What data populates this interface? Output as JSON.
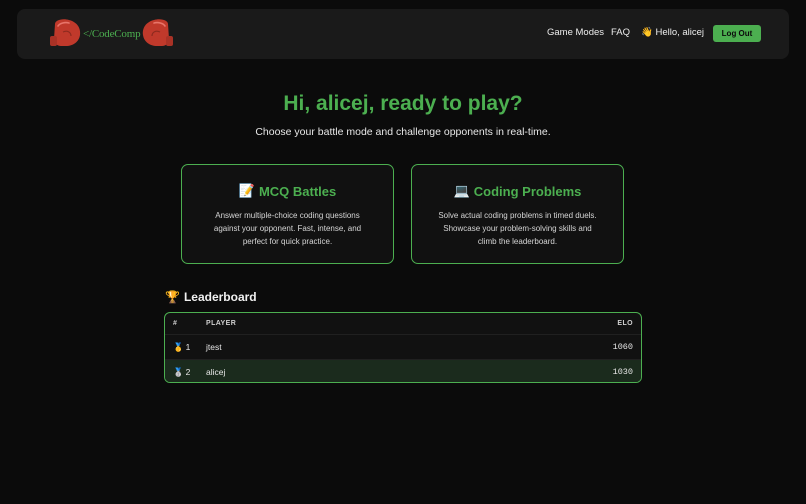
{
  "nav": {
    "logo_text": "</CodeComp",
    "links": [
      "Game Modes",
      "FAQ"
    ],
    "greeting": "👋 Hello, alicej",
    "logout_label": "Log Out"
  },
  "hero": {
    "title": "Hi, alicej, ready to play?",
    "subtitle": "Choose your battle mode and challenge opponents in real-time."
  },
  "modes": [
    {
      "icon": "📝",
      "title": "MCQ Battles",
      "description": "Answer multiple-choice coding questions against your opponent. Fast, intense, and perfect for quick practice."
    },
    {
      "icon": "💻",
      "title": "Coding Problems",
      "description": "Solve actual coding problems in timed duels. Showcase your problem-solving skills and climb the leaderboard."
    }
  ],
  "leaderboard": {
    "icon": "🏆",
    "title": "Leaderboard",
    "headers": {
      "rank": "#",
      "player": "PLAYER",
      "elo": "ELO"
    },
    "rows": [
      {
        "medal": "🥇",
        "rank": "1",
        "player": "jtest",
        "elo": "1060"
      },
      {
        "medal": "🥈",
        "rank": "2",
        "player": "alicej",
        "elo": "1030"
      }
    ]
  },
  "colors": {
    "accent": "#4caf50",
    "background": "#0b0b0b",
    "navbar": "#1a1a1a",
    "glove": "#c0392b"
  }
}
